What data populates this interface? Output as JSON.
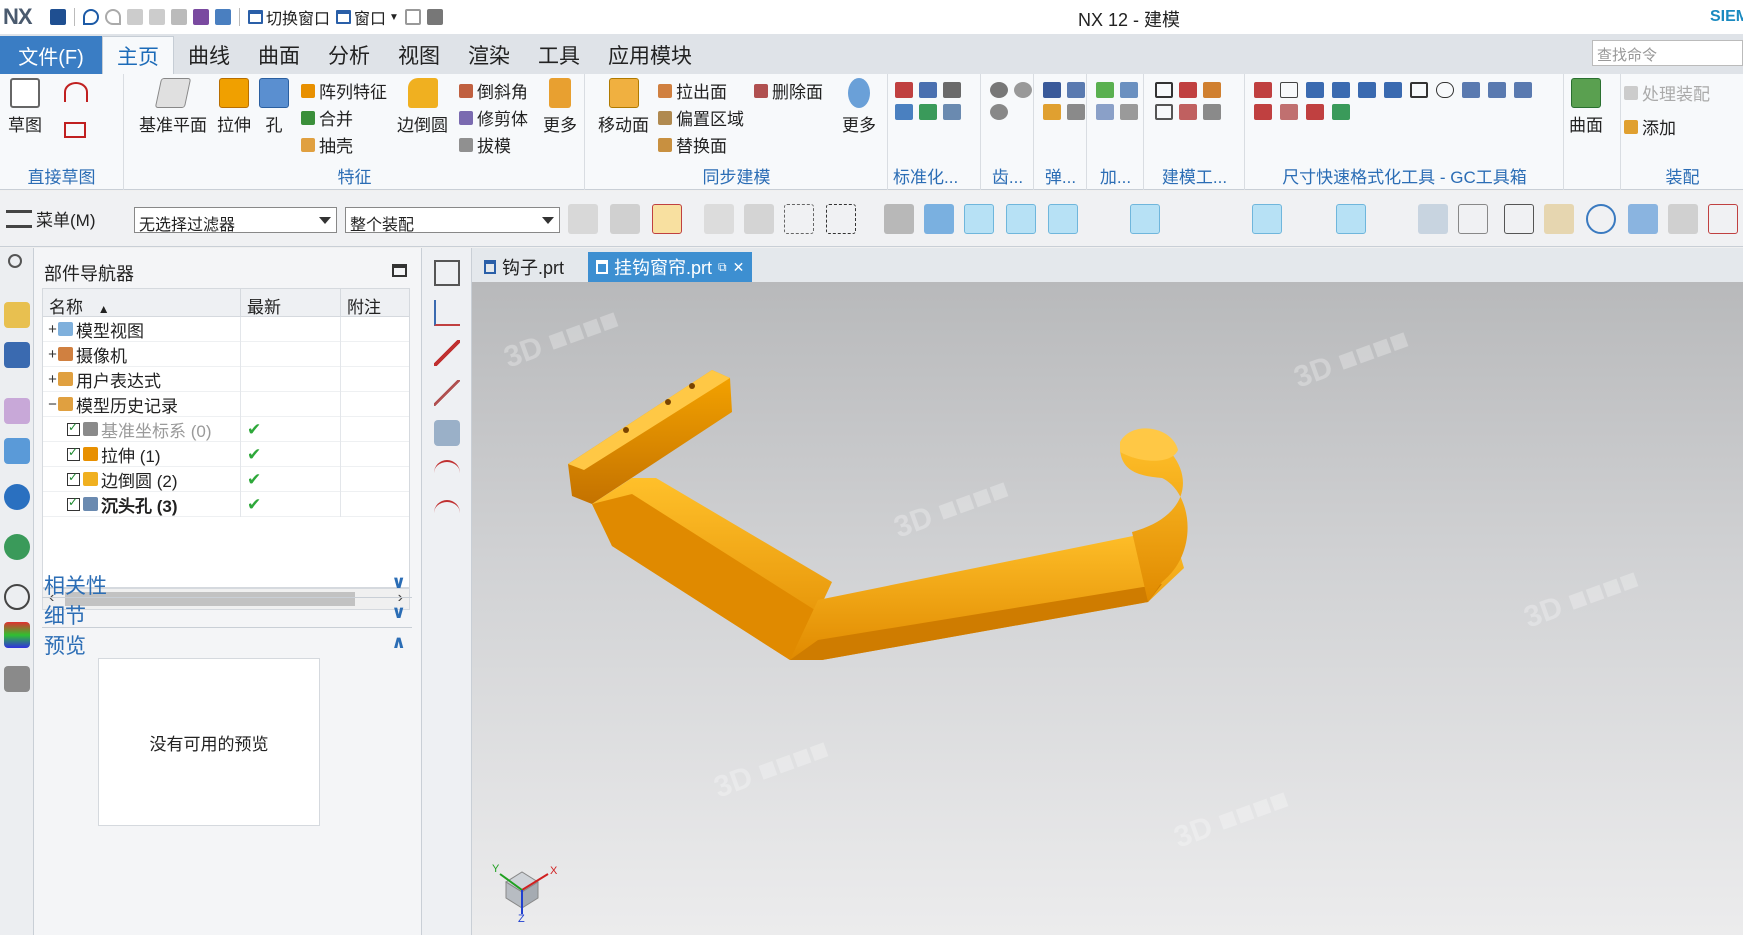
{
  "titlebar": {
    "logo": "NX",
    "switch_window": "切换窗口",
    "window_menu": "窗口",
    "title": "NX 12 - 建模",
    "brand": "SIEMENS"
  },
  "tabs": {
    "file": "文件(F)",
    "items": [
      "主页",
      "曲线",
      "曲面",
      "分析",
      "视图",
      "渲染",
      "工具",
      "应用模块"
    ],
    "search_placeholder": "查找命令"
  },
  "ribbon": {
    "direct_sketch": {
      "label": "直接草图",
      "sketch": "草图"
    },
    "feature": {
      "label": "特征",
      "datum_plane": "基准平面",
      "extrude": "拉伸",
      "hole": "孔",
      "pattern": "阵列特征",
      "unite": "合并",
      "shell": "抽壳",
      "edge_blend": "边倒圆",
      "chamfer": "倒斜角",
      "trim_body": "修剪体",
      "draft": "拔模",
      "more": "更多"
    },
    "sync": {
      "label": "同步建模",
      "move_face": "移动面",
      "pull_face": "拉出面",
      "offset_region": "偏置区域",
      "replace_face": "替换面",
      "delete_face": "删除面",
      "more": "更多"
    },
    "std": "标准化...",
    "gear": "齿...",
    "spring": "弹...",
    "add": "加...",
    "modeling_tools": "建模工...",
    "gc": "尺寸快速格式化工具 - GC工具箱",
    "surface": "曲面",
    "assembly": {
      "label": "装配",
      "process": "处理装配",
      "add": "添加"
    }
  },
  "cmdbar": {
    "menu": "菜单(M)",
    "filter": "无选择过滤器",
    "scope": "整个装配"
  },
  "navigator": {
    "title": "部件导航器",
    "columns": [
      "名称",
      "最新",
      "附注"
    ],
    "rows": [
      {
        "expander": "+",
        "name": "模型视图",
        "latest": "",
        "indent": 0,
        "check": false,
        "bold": false,
        "dim": false
      },
      {
        "expander": "+",
        "name": "摄像机",
        "latest": "",
        "indent": 0,
        "check": false,
        "bold": false,
        "dim": false
      },
      {
        "expander": "+",
        "name": "用户表达式",
        "latest": "",
        "indent": 0,
        "check": false,
        "bold": false,
        "dim": false
      },
      {
        "expander": "−",
        "name": "模型历史记录",
        "latest": "",
        "indent": 0,
        "check": false,
        "bold": false,
        "dim": false
      },
      {
        "expander": "",
        "name": "基准坐标系 (0)",
        "latest": "✔",
        "indent": 1,
        "check": true,
        "bold": false,
        "dim": true
      },
      {
        "expander": "",
        "name": "拉伸 (1)",
        "latest": "✔",
        "indent": 1,
        "check": true,
        "bold": false,
        "dim": false
      },
      {
        "expander": "",
        "name": "边倒圆 (2)",
        "latest": "✔",
        "indent": 1,
        "check": true,
        "bold": false,
        "dim": false
      },
      {
        "expander": "",
        "name": "沉头孔 (3)",
        "latest": "✔",
        "indent": 1,
        "check": true,
        "bold": true,
        "dim": false
      }
    ],
    "sections": {
      "dependencies": "相关性",
      "details": "细节",
      "preview": "预览"
    },
    "no_preview": "没有可用的预览"
  },
  "documents": {
    "tabs": [
      {
        "name": "钩子.prt",
        "active": false
      },
      {
        "name": "挂钩窗帘.prt",
        "active": true
      }
    ]
  },
  "viewport": {
    "model_color": "#f5a000",
    "triad": {
      "x": "X",
      "y": "Y",
      "z": "Z"
    }
  }
}
